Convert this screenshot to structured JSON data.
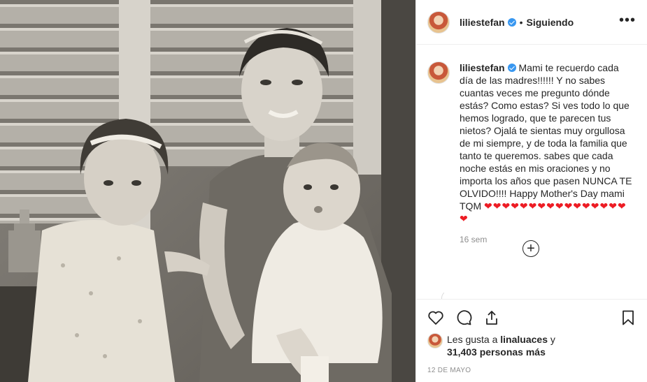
{
  "post": {
    "image_description_name": "vintage-family-photo"
  },
  "header": {
    "username": "liliestefan",
    "separator": "•",
    "follow_status": "Siguiendo",
    "more": "•••"
  },
  "caption": {
    "username": "liliestefan",
    "text": "Mami te recuerdo cada día de las madres!!!!!! Y no sabes cuantas veces me pregunto dónde estás? Como estas? Si ves todo lo que hemos logrado, que te parecen tus nietos? Ojalá te sientas muy orgullosa de mi siempre, y de toda la familia que tanto te queremos. sabes que cada noche estás en mis oraciones y no importa los años que pasen NUNCA TE OLVIDO!!!! Happy Mother's Day mami TQM",
    "hearts": "❤️❤️❤️❤️❤️❤️❤️❤️❤️❤️❤️❤️❤️❤️❤️❤️❤️❤️",
    "hearts_display": "❤❤❤❤❤❤❤❤❤❤❤❤❤❤❤❤❤",
    "time_ago": "16 sem"
  },
  "load_more": "+",
  "likes": {
    "prefix": "Les gusta a ",
    "user": "linaluaces",
    "suffix": " y ",
    "count": "31,403 personas más"
  },
  "date": "12 DE MAYO",
  "icons": [
    "heart-icon",
    "comment-icon",
    "share-icon",
    "bookmark-icon",
    "verified-badge-icon",
    "add-circle-icon",
    "more-options-icon"
  ],
  "colors": {
    "accent": "#3897f0",
    "heart": "#ed1c24",
    "muted": "#8e8e8e",
    "text": "#262626"
  }
}
